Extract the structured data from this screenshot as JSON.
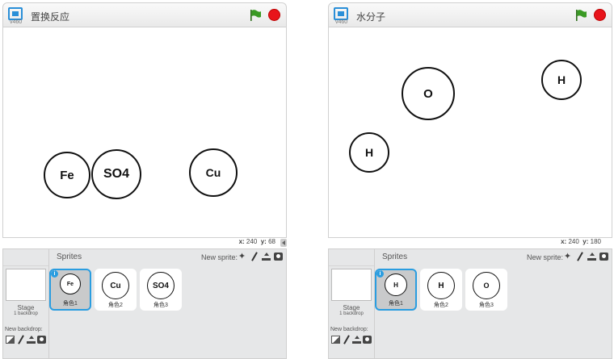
{
  "left": {
    "title": "置换反应",
    "version": "v460",
    "atoms": [
      {
        "label": "Fe"
      },
      {
        "label": "SO4"
      },
      {
        "label": "Cu"
      }
    ],
    "coords": {
      "x_label": "x:",
      "x": "240",
      "y_label": "y:",
      "y": "68"
    },
    "sprites_title": "Sprites",
    "new_sprite_label": "New sprite:",
    "stage_label": "Stage",
    "stage_backdrops": "1 backdrop",
    "new_backdrop_label": "New backdrop:",
    "sprites": [
      {
        "name": "角色1",
        "symbol": "Fe",
        "selected": true
      },
      {
        "name": "角色2",
        "symbol": "Cu",
        "selected": false
      },
      {
        "name": "角色3",
        "symbol": "SO4",
        "selected": false
      }
    ]
  },
  "right": {
    "title": "水分子",
    "version": "v460",
    "atoms": [
      {
        "label": "O"
      },
      {
        "label": "H"
      },
      {
        "label": "H"
      }
    ],
    "coords": {
      "x_label": "x:",
      "x": "240",
      "y_label": "y:",
      "y": "180"
    },
    "sprites_title": "Sprites",
    "new_sprite_label": "New sprite:",
    "stage_label": "Stage",
    "stage_backdrops": "1 backdrop",
    "new_backdrop_label": "New backdrop:",
    "sprites": [
      {
        "name": "角色1",
        "symbol": "H",
        "selected": true
      },
      {
        "name": "角色2",
        "symbol": "H",
        "selected": false
      },
      {
        "name": "角色3",
        "symbol": "O",
        "selected": false
      }
    ]
  },
  "colors": {
    "flag": "#3a9a24",
    "stop": "#e8141b",
    "selection": "#2a9de0"
  },
  "icons": [
    "fullscreen-icon",
    "green-flag-icon",
    "stop-icon",
    "paint-icon",
    "brush-icon",
    "upload-icon",
    "camera-icon",
    "library-icon",
    "info-icon"
  ]
}
